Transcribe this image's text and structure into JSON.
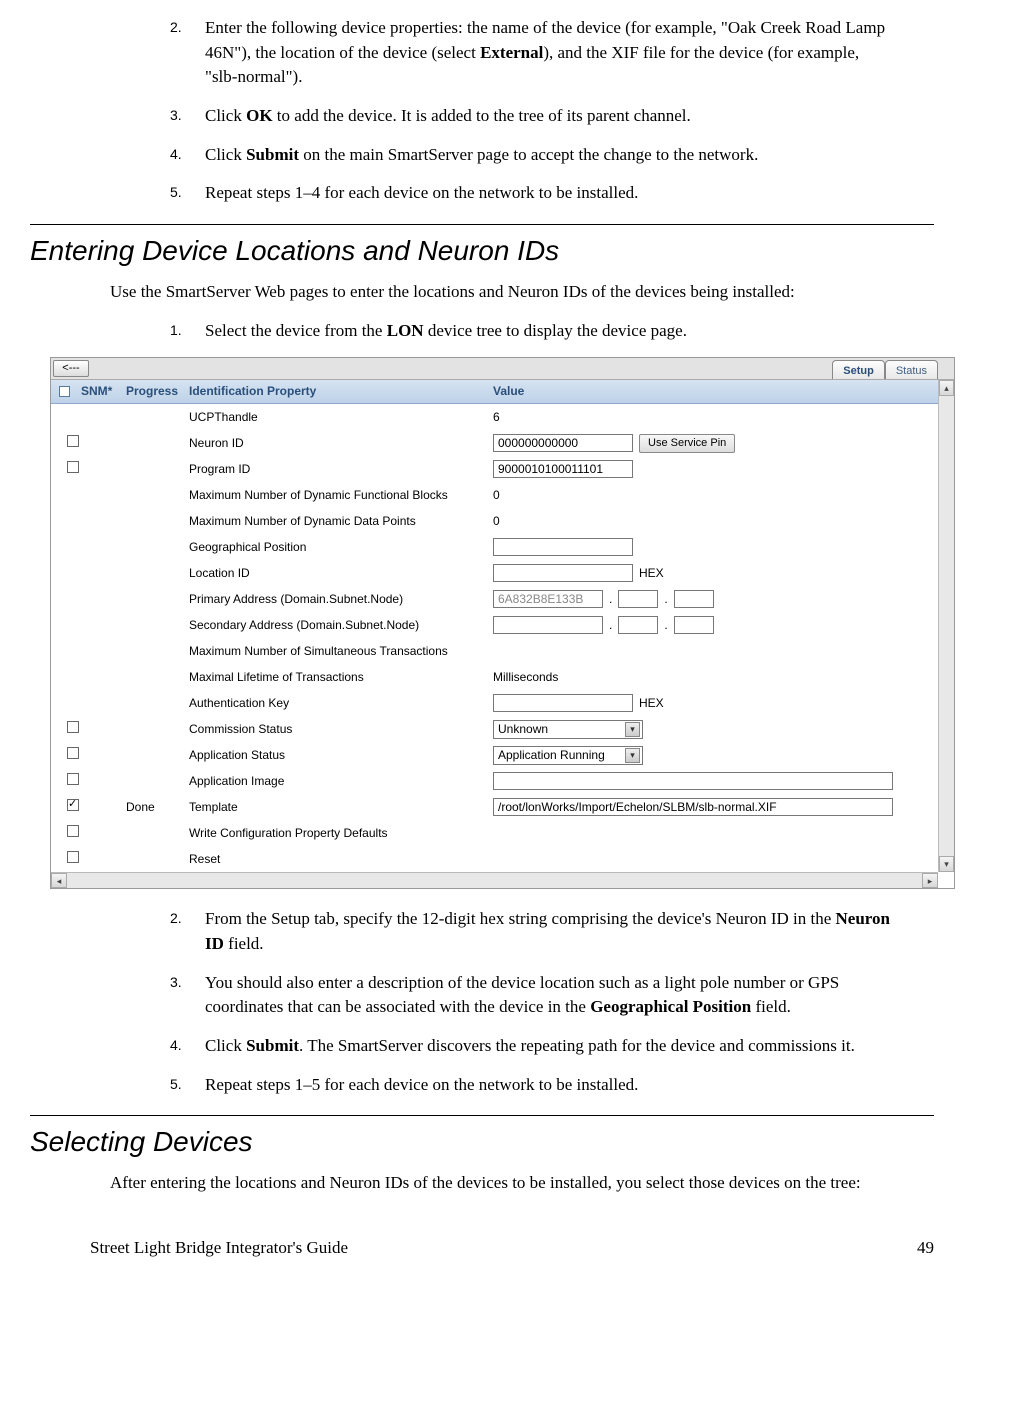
{
  "steps1": [
    {
      "num": "2.",
      "text_pre": "Enter the following device properties:  the name of the device (for example, \"Oak Creek Road Lamp 46N\"), the location of the device (select ",
      "bold1": "External",
      "text_post": "), and the XIF file for the device (for example, \"slb-normal\")."
    },
    {
      "num": "3.",
      "text_pre": "Click ",
      "bold1": "OK",
      "text_post": " to add the device.  It is added to the tree of its parent channel."
    },
    {
      "num": "4.",
      "text_pre": "Click ",
      "bold1": "Submit",
      "text_post": " on the main SmartServer page to accept the change to the network."
    },
    {
      "num": "5.",
      "text_pre": "Repeat steps 1–4 for each device on the network to be installed.",
      "bold1": "",
      "text_post": ""
    }
  ],
  "section1_title": "Entering Device Locations and Neuron IDs",
  "section1_body": "Use the SmartServer Web pages to enter the locations and Neuron IDs of the devices being installed:",
  "step_select": {
    "num": "1.",
    "pre": "Select the device from the ",
    "bold": "LON",
    "post": " device tree to display the device page."
  },
  "screenshot": {
    "back": "<---",
    "tab_setup": "Setup",
    "tab_status": "Status",
    "hdr_snm": "SNM*",
    "hdr_progress": "Progress",
    "hdr_idprop": "Identification Property",
    "hdr_value": "Value",
    "service_pin_btn": "Use Service Pin",
    "rows": [
      {
        "check": false,
        "no_check": true,
        "prog": "",
        "prop": "UCPThandle",
        "vtype": "text",
        "val": "6"
      },
      {
        "check": false,
        "prog": "",
        "prop": "Neuron ID",
        "vtype": "input-btn",
        "val": "000000000000"
      },
      {
        "check": false,
        "prog": "",
        "prop": "Program ID",
        "vtype": "input",
        "val": "9000010100011101"
      },
      {
        "check": false,
        "no_check": true,
        "prog": "",
        "prop": "Maximum Number of Dynamic Functional Blocks",
        "vtype": "text",
        "val": "0"
      },
      {
        "check": false,
        "no_check": true,
        "prog": "",
        "prop": "Maximum Number of Dynamic Data Points",
        "vtype": "text",
        "val": "0"
      },
      {
        "check": false,
        "no_check": true,
        "prog": "",
        "prop": "Geographical Position",
        "vtype": "input",
        "val": ""
      },
      {
        "check": false,
        "no_check": true,
        "prog": "",
        "prop": "Location ID",
        "vtype": "input-hex",
        "val": ""
      },
      {
        "check": false,
        "no_check": true,
        "prog": "",
        "prop": "Primary Address (Domain.Subnet.Node)",
        "vtype": "addr",
        "val": "6A832B8E133B",
        "gray": true
      },
      {
        "check": false,
        "no_check": true,
        "prog": "",
        "prop": "Secondary Address (Domain.Subnet.Node)",
        "vtype": "addr",
        "val": ""
      },
      {
        "check": false,
        "no_check": true,
        "prog": "",
        "prop": "Maximum Number of Simultaneous Transactions",
        "vtype": "text",
        "val": ""
      },
      {
        "check": false,
        "no_check": true,
        "prog": "",
        "prop": "Maximal Lifetime of Transactions",
        "vtype": "text",
        "val": "Milliseconds"
      },
      {
        "check": false,
        "no_check": true,
        "prog": "",
        "prop": "Authentication Key",
        "vtype": "input-hex",
        "val": ""
      },
      {
        "check": false,
        "prog": "",
        "prop": "Commission Status",
        "vtype": "select",
        "val": "Unknown"
      },
      {
        "check": false,
        "prog": "",
        "prop": "Application Status",
        "vtype": "select",
        "val": "Application Running"
      },
      {
        "check": false,
        "prog": "",
        "prop": "Application Image",
        "vtype": "input-wide",
        "val": ""
      },
      {
        "check": true,
        "prog": "Done",
        "prop": "Template",
        "vtype": "input-wide",
        "val": "/root/lonWorks/Import/Echelon/SLBM/slb-normal.XIF"
      },
      {
        "check": false,
        "prog": "",
        "prop": "Write Configuration Property Defaults",
        "vtype": "none",
        "val": ""
      },
      {
        "check": false,
        "prog": "",
        "prop": "Reset",
        "vtype": "none",
        "val": ""
      }
    ],
    "hex_label": "HEX"
  },
  "steps2": [
    {
      "num": "2.",
      "pre": "From the Setup tab, specify the 12-digit hex string comprising the device's Neuron ID in the ",
      "bold": "Neuron ID",
      "post": " field."
    },
    {
      "num": "3.",
      "pre": "You should also enter a description of the device location such as a light pole number or GPS coordinates that can be associated with the device in the ",
      "bold": "Geographical Position",
      "post": " field."
    },
    {
      "num": "4.",
      "pre": "Click ",
      "bold": "Submit",
      "post": ".  The SmartServer discovers the repeating path for the device and commissions it."
    },
    {
      "num": "5.",
      "pre": "Repeat steps 1–5 for each device on the network to be installed.",
      "bold": "",
      "post": ""
    }
  ],
  "section2_title": "Selecting Devices",
  "section2_body": "After entering the locations and Neuron IDs of the devices to be installed, you select those devices on the tree:",
  "footer_left": "Street Light Bridge Integrator's Guide",
  "footer_right": "49"
}
